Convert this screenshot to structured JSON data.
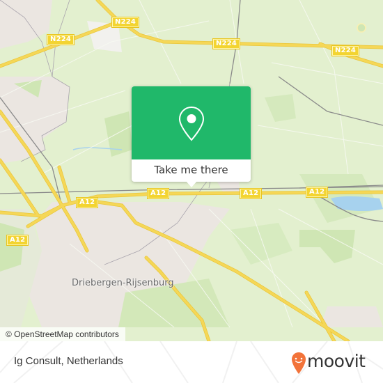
{
  "map": {
    "road_labels": [
      {
        "id": "n224-a",
        "text": "N224"
      },
      {
        "id": "n224-b",
        "text": "N224"
      },
      {
        "id": "n224-c",
        "text": "N224"
      },
      {
        "id": "n224-d",
        "text": "N224"
      },
      {
        "id": "a12-a",
        "text": "A12"
      },
      {
        "id": "a12-b",
        "text": "A12"
      },
      {
        "id": "a12-c",
        "text": "A12"
      },
      {
        "id": "a12-d",
        "text": "A12"
      },
      {
        "id": "a12-e",
        "text": "A12"
      }
    ],
    "town_label": "Driebergen-Rijsenburg",
    "attribution": "© OpenStreetMap contributors",
    "colors": {
      "land": "#e3f0cf",
      "urban": "#ebe6e1",
      "forest": "#cfe6b4",
      "road": "#f5d757",
      "water": "#a7d2ee",
      "rail": "#8a8a8a"
    }
  },
  "popup": {
    "icon": "map-pin-icon",
    "button_label": "Take me there",
    "color": "#20b86a"
  },
  "footer": {
    "place_name": "Ig Consult, Netherlands",
    "brand": "moovit",
    "brand_color": "#f2733a"
  }
}
